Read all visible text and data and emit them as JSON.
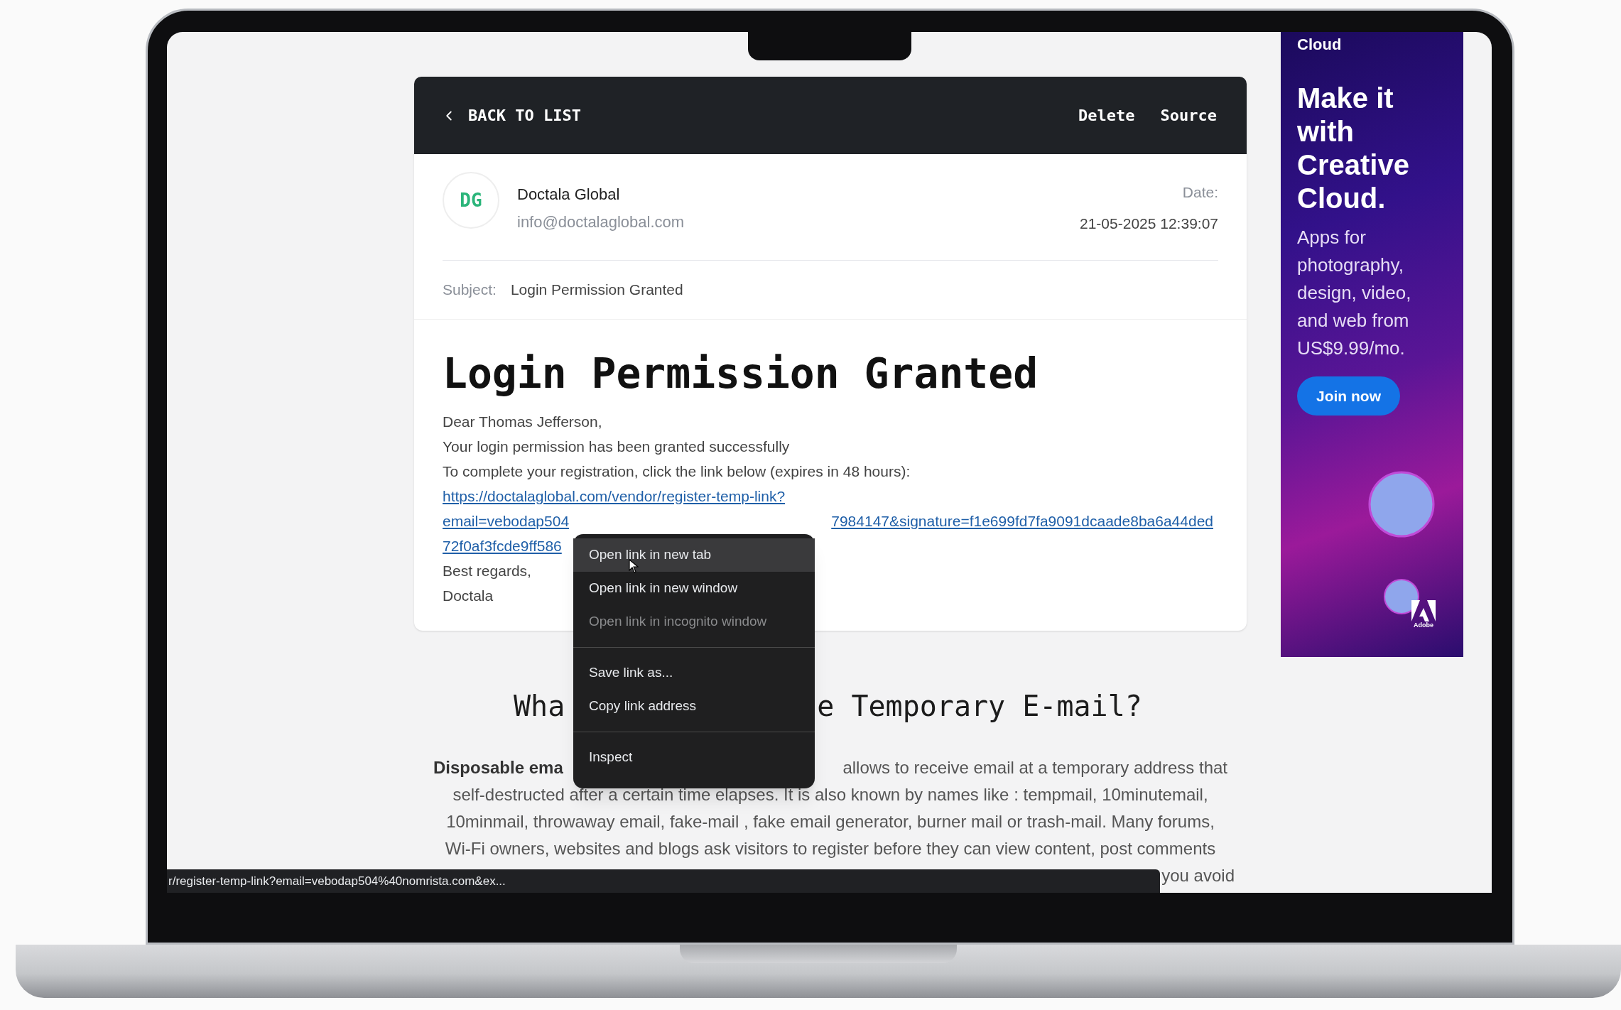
{
  "email_view": {
    "toolbar": {
      "back": "BACK TO LIST",
      "actions": [
        "Delete",
        "Source"
      ]
    },
    "sender": {
      "initials": "DG",
      "name": "Doctala Global",
      "address": "info@doctalaglobal.com"
    },
    "date": {
      "label": "Date:",
      "value": "21-05-2025 12:39:07"
    },
    "subject": {
      "label": "Subject:",
      "value": "Login Permission Granted"
    },
    "message": {
      "title": "Login Permission Granted",
      "lines": [
        "Dear Thomas Jefferson,",
        "Your login permission has been granted successfully",
        "To complete your registration, click the link below (expires in 48 hours):"
      ],
      "link_lines": [
        {
          "parts": [
            "https://doctalaglobal.com/vendor/register-temp-link?"
          ]
        },
        {
          "parts": [
            "email=vebodap504",
            "7984147&signature=f1e699fd7fa9091dcaade8ba6a44ded"
          ]
        },
        {
          "parts": [
            "72f0af3fcde9ff586"
          ]
        }
      ],
      "closing": [
        "Best regards,",
        "Doctala"
      ]
    }
  },
  "article": {
    "heading": [
      "Wha",
      "e Temporary E-mail?"
    ],
    "lines": [
      {
        "parts": [
          {
            "text": "Disposable ema",
            "bold": true
          },
          {
            "text": "allows to receive email at a temporary address that",
            "bold": false
          }
        ]
      },
      {
        "parts": [
          {
            "text": "self-destructed after a certain time elapses. It is also known by names like : tempmail, 10minutemail,",
            "bold": false
          }
        ]
      },
      {
        "parts": [
          {
            "text": "10minmail, throwaway email, fake-mail , fake email generator, burner mail or trash-mail. Many forums,",
            "bold": false
          }
        ]
      },
      {
        "parts": [
          {
            "text": "Wi-Fi owners, websites and blogs ask visitors to register before they can view content, post comments",
            "bold": false
          }
        ]
      },
      {
        "parts": [
          {
            "text": "you avoid",
            "bold": false
          }
        ]
      }
    ]
  },
  "ad": {
    "brand": "Cloud",
    "headline": [
      "Make it",
      "with",
      "Creative",
      "Cloud."
    ],
    "body": [
      "Apps for",
      "photography,",
      "design, video,",
      "and web from",
      "US$9.99/mo."
    ],
    "button": "Join now",
    "logo_text": "Adobe"
  },
  "context_menu": {
    "items": [
      {
        "kind": "item",
        "label": "Open link in new tab",
        "highlighted": true,
        "disabled": false
      },
      {
        "kind": "item",
        "label": "Open link in new window",
        "highlighted": false,
        "disabled": false
      },
      {
        "kind": "item",
        "label": "Open link in incognito window",
        "highlighted": false,
        "disabled": true
      },
      {
        "kind": "separator"
      },
      {
        "kind": "item",
        "label": "Save link as...",
        "highlighted": false,
        "disabled": false
      },
      {
        "kind": "item",
        "label": "Copy link address",
        "highlighted": false,
        "disabled": false
      },
      {
        "kind": "separator"
      },
      {
        "kind": "item",
        "label": "Inspect",
        "highlighted": false,
        "disabled": false
      }
    ]
  },
  "status_bar": {
    "url": "r/register-temp-link?email=vebodap504%40nomrista.com&ex..."
  }
}
